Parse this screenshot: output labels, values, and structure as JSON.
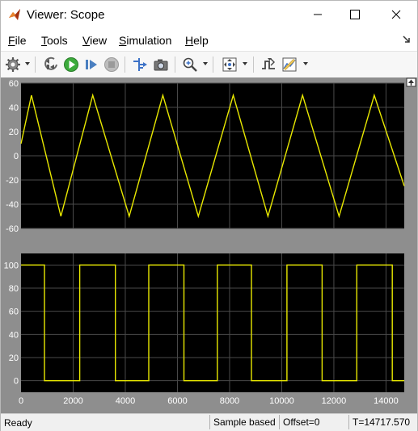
{
  "window": {
    "title": "Viewer: Scope"
  },
  "menu": {
    "items": [
      {
        "label": "File",
        "mnemonic": "F",
        "rest": "ile"
      },
      {
        "label": "Tools",
        "mnemonic": "T",
        "rest": "ools"
      },
      {
        "label": "View",
        "mnemonic": "V",
        "rest": "iew"
      },
      {
        "label": "Simulation",
        "mnemonic": "S",
        "rest": "imulation"
      },
      {
        "label": "Help",
        "mnemonic": "H",
        "rest": "elp"
      }
    ]
  },
  "toolbar": {
    "icons": [
      "settings-gear-icon",
      "step-back-icon",
      "run-icon",
      "step-forward-icon",
      "stop-icon",
      "highlight-signal-icon",
      "camera-snapshot-icon",
      "zoom-in-icon",
      "autoscale-icon",
      "triggers-icon",
      "measurements-icon"
    ]
  },
  "status": {
    "left": "Ready",
    "mode": "Sample based",
    "offset": "Offset=0",
    "time": "T=14717.570"
  },
  "colors": {
    "plot_background": "#000000",
    "signal": "#e8e800",
    "grid": "#4a4a4a",
    "frame_background": "#8e8e8e",
    "tick_text": "#ffffff"
  },
  "chart_data": [
    {
      "type": "line",
      "title": "",
      "xlabel": "",
      "ylabel": "",
      "xlim": [
        0,
        14700
      ],
      "ylim": [
        -60,
        60
      ],
      "yticks": [
        "60",
        "40",
        "20",
        "0",
        "-20",
        "-40",
        "-60"
      ],
      "grid": true,
      "series": [
        {
          "waveform": "triangle",
          "x": [
            0,
            400,
            1530,
            2750,
            4150,
            5440,
            6800,
            8140,
            9470,
            10800,
            12200,
            13550,
            14700
          ],
          "y": [
            10,
            50,
            -50,
            50,
            -50,
            50,
            -50,
            50,
            -50,
            50,
            -50,
            50,
            -25
          ]
        }
      ]
    },
    {
      "type": "line",
      "title": "",
      "xlabel": "",
      "ylabel": "",
      "xlim": [
        0,
        14700
      ],
      "ylim": [
        -10,
        110
      ],
      "yticks": [
        "100",
        "80",
        "60",
        "40",
        "20",
        "0"
      ],
      "xticks": [
        "0",
        "2000",
        "4000",
        "6000",
        "8000",
        "10000",
        "12000",
        "14000"
      ],
      "grid": true,
      "series": [
        {
          "waveform": "square",
          "x": [
            0,
            900,
            900,
            2250,
            2250,
            3620,
            3620,
            4900,
            4900,
            6250,
            6250,
            7530,
            7530,
            8840,
            8840,
            10200,
            10200,
            11550,
            11550,
            12880,
            12880,
            14240,
            14240,
            14700
          ],
          "y": [
            100,
            100,
            0,
            0,
            100,
            100,
            0,
            0,
            100,
            100,
            0,
            0,
            100,
            100,
            0,
            0,
            100,
            100,
            0,
            0,
            100,
            100,
            0,
            0
          ]
        }
      ]
    }
  ]
}
